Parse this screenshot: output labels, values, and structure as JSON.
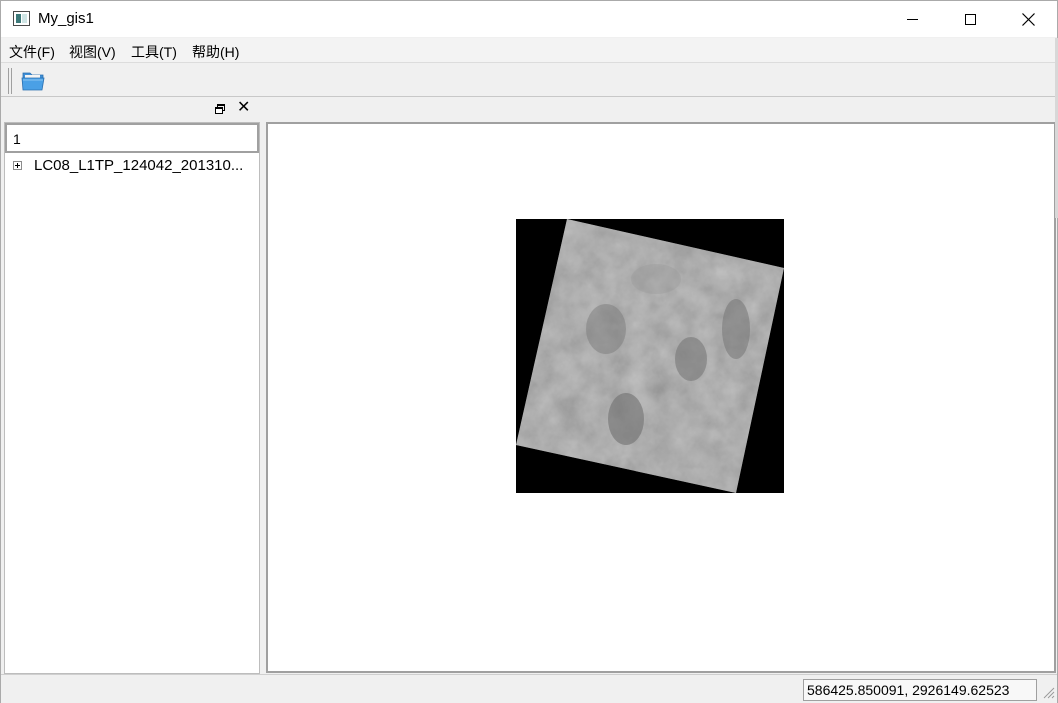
{
  "window": {
    "title": "My_gis1"
  },
  "icons": {
    "app": "app-window-icon",
    "minimize": "minimize-icon",
    "maximize": "maximize-icon",
    "close": "close-icon",
    "open": "folder-open-icon",
    "dock_float": "dock-float-icon",
    "dock_close": "dock-close-icon",
    "expander": "plus-expander-icon"
  },
  "menubar": {
    "items": [
      "文件(F)",
      "视图(V)",
      "工具(T)",
      "帮助(H)"
    ]
  },
  "dock": {
    "close_glyph": "✕"
  },
  "layers_panel": {
    "header": "1",
    "items": [
      {
        "label": "LC08_L1TP_124042_201310..."
      }
    ]
  },
  "map": {
    "layer": "satellite-raster-image"
  },
  "statusbar": {
    "coordinates": "586425.850091, 2926149.62523"
  }
}
